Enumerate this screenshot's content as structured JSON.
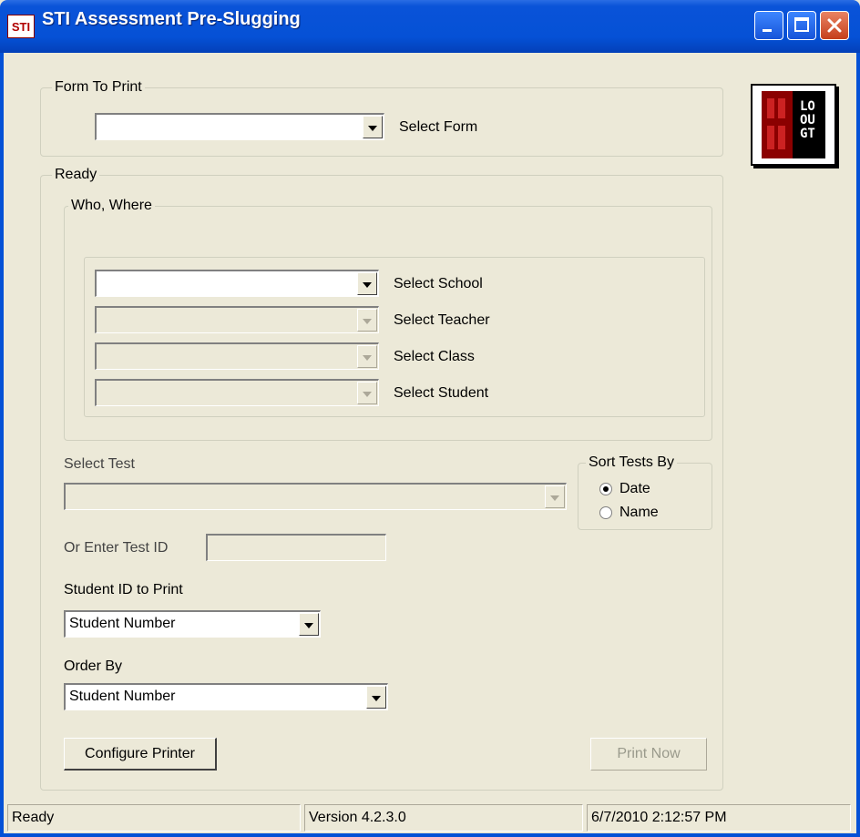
{
  "window": {
    "title": "STI Assessment Pre-Slugging",
    "app_icon_text": "STI"
  },
  "form_to_print": {
    "group_label": "Form To Print",
    "combo_value": "",
    "select_label": "Select Form"
  },
  "logo": {
    "lines": [
      "LO",
      "OU",
      "GT"
    ]
  },
  "ready": {
    "group_label": "Ready",
    "who_where": {
      "group_label": "Who, Where",
      "school_label": "Select School",
      "teacher_label": "Select Teacher",
      "class_label": "Select Class",
      "student_label": "Select Student"
    },
    "select_test_label": "Select Test",
    "sort_tests": {
      "group_label": "Sort Tests By",
      "options": [
        "Date",
        "Name"
      ],
      "selected": "Date"
    },
    "enter_test_id_label": "Or Enter Test ID",
    "test_id_value": "",
    "student_id_to_print": {
      "label": "Student ID to Print",
      "value": "Student Number"
    },
    "order_by": {
      "label": "Order By",
      "value": "Student Number"
    },
    "configure_printer_label": "Configure Printer",
    "print_now_label": "Print Now"
  },
  "status_bar": {
    "status": "Ready",
    "version": "Version 4.2.3.0",
    "datetime": "6/7/2010 2:12:57 PM"
  }
}
